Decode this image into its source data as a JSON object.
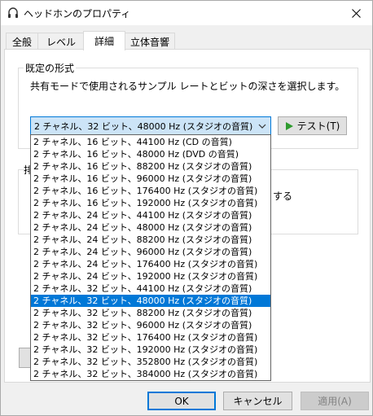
{
  "window": {
    "title": "ヘッドホンのプロパティ",
    "close_glyph": "✕"
  },
  "tabs": [
    {
      "label": "全般"
    },
    {
      "label": "レベル"
    },
    {
      "label": "詳細"
    },
    {
      "label": "立体音響"
    }
  ],
  "default_format": {
    "group_title": "既定の形式",
    "description": "共有モードで使用されるサンプル レートとビットの深さを選択します。",
    "selected_value": "2 チャネル、32 ビット、48000 Hz (スタジオの音質)",
    "test_button_label": "テスト(T)"
  },
  "partially_hidden": {
    "left_label": "排",
    "right_text": "する"
  },
  "dropdown_options": [
    "2 チャネル、16 ビット、44100 Hz (CD の音質)",
    "2 チャネル、16 ビット、48000 Hz (DVD の音質)",
    "2 チャネル、16 ビット、88200 Hz (スタジオの音質)",
    "2 チャネル、16 ビット、96000 Hz (スタジオの音質)",
    "2 チャネル、16 ビット、176400 Hz (スタジオの音質)",
    "2 チャネル、16 ビット、192000 Hz (スタジオの音質)",
    "2 チャネル、24 ビット、44100 Hz (スタジオの音質)",
    "2 チャネル、24 ビット、48000 Hz (スタジオの音質)",
    "2 チャネル、24 ビット、88200 Hz (スタジオの音質)",
    "2 チャネル、24 ビット、96000 Hz (スタジオの音質)",
    "2 チャネル、24 ビット、176400 Hz (スタジオの音質)",
    "2 チャネル、24 ビット、192000 Hz (スタジオの音質)",
    "2 チャネル、32 ビット、44100 Hz (スタジオの音質)",
    "2 チャネル、32 ビット、48000 Hz (スタジオの音質)",
    "2 チャネル、32 ビット、88200 Hz (スタジオの音質)",
    "2 チャネル、32 ビット、96000 Hz (スタジオの音質)",
    "2 チャネル、32 ビット、176400 Hz (スタジオの音質)",
    "2 チャネル、32 ビット、192000 Hz (スタジオの音質)",
    "2 チャネル、32 ビット、352800 Hz (スタジオの音質)",
    "2 チャネル、32 ビット、384000 Hz (スタジオの音質)"
  ],
  "selected_option_index": 13,
  "footer": {
    "ok_label": "OK",
    "cancel_label": "キャンセル",
    "apply_label": "適用(A)"
  },
  "colors": {
    "accent": "#0078d7",
    "play_icon": "#2e9b2e"
  }
}
